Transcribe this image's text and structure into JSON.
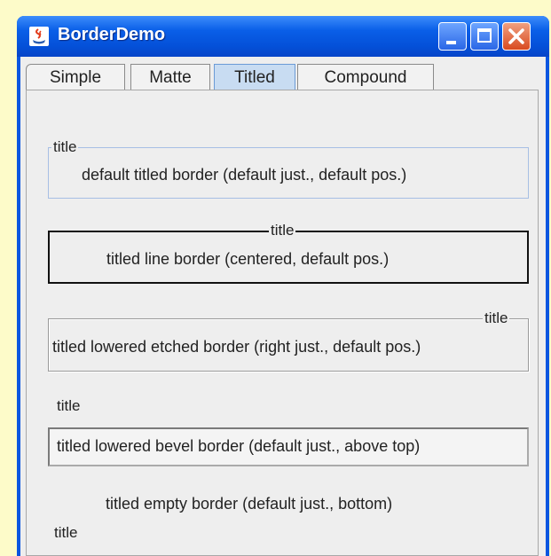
{
  "window": {
    "title": "BorderDemo"
  },
  "tabs": [
    {
      "label": "Simple"
    },
    {
      "label": "Matte"
    },
    {
      "label": "Titled"
    },
    {
      "label": "Compound"
    }
  ],
  "selected_tab": "Titled",
  "borders": [
    {
      "title": "title",
      "text": "default titled border (default just., default pos.)"
    },
    {
      "title": "title",
      "text": "titled line border (centered, default pos.)"
    },
    {
      "title": "title",
      "text": "titled lowered etched border (right just., default pos.)"
    },
    {
      "title": "title",
      "text": "titled lowered bevel border (default just., above top)"
    },
    {
      "title": "title",
      "text": "titled empty border (default just., bottom)"
    }
  ],
  "colors": {
    "titlebar": "#0a5fe8",
    "selected_tab": "#c8dcf2",
    "panel": "#eeeeee"
  },
  "icons": [
    "java-app-icon",
    "minimize-icon",
    "maximize-icon",
    "close-icon"
  ]
}
